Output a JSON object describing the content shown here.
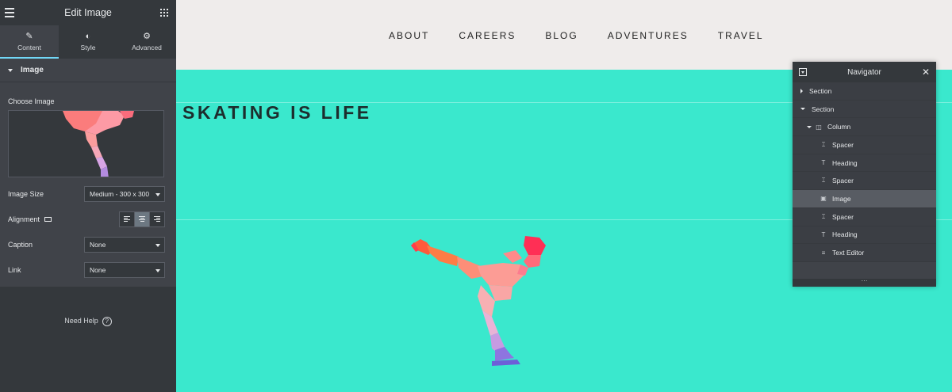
{
  "panel": {
    "title": "Edit Image",
    "tabs": [
      {
        "label": "Content",
        "icon": "pencil-icon"
      },
      {
        "label": "Style",
        "icon": "half-circle-icon"
      },
      {
        "label": "Advanced",
        "icon": "gear-icon"
      }
    ],
    "section": "Image",
    "choose_image_label": "Choose Image",
    "image_size": {
      "label": "Image Size",
      "value": "Medium - 300 x 300"
    },
    "alignment": {
      "label": "Alignment",
      "options": [
        "left",
        "center",
        "right"
      ],
      "selected": "center"
    },
    "caption": {
      "label": "Caption",
      "value": "None"
    },
    "link": {
      "label": "Link",
      "value": "None"
    },
    "help": "Need Help"
  },
  "site": {
    "nav": [
      "ABOUT",
      "CAREERS",
      "BLOG",
      "ADVENTURES",
      "TRAVEL"
    ],
    "hero_title": "SKATING IS LIFE"
  },
  "navigator": {
    "title": "Navigator",
    "items": [
      {
        "label": "Section",
        "icon": "expand-arrow-icon",
        "selected": false
      },
      {
        "label": "Section",
        "icon": "collapse-arrow-icon",
        "selected": false
      },
      {
        "label": "Column",
        "icon": "column-icon",
        "selected": false
      },
      {
        "label": "Spacer",
        "icon": "spacer-icon",
        "selected": false
      },
      {
        "label": "Heading",
        "icon": "heading-icon",
        "selected": false
      },
      {
        "label": "Spacer",
        "icon": "spacer-icon",
        "selected": false
      },
      {
        "label": "Image",
        "icon": "image-icon",
        "selected": true
      },
      {
        "label": "Spacer",
        "icon": "spacer-icon",
        "selected": false
      },
      {
        "label": "Heading",
        "icon": "heading-icon",
        "selected": false
      },
      {
        "label": "Text Editor",
        "icon": "text-editor-icon",
        "selected": false
      }
    ]
  },
  "colors": {
    "panel_bg": "#404349",
    "panel_dark": "#34383c",
    "accent": "#71d7f7",
    "hero_bg": "#3ae8cd",
    "topbar_bg": "#efeceb"
  }
}
